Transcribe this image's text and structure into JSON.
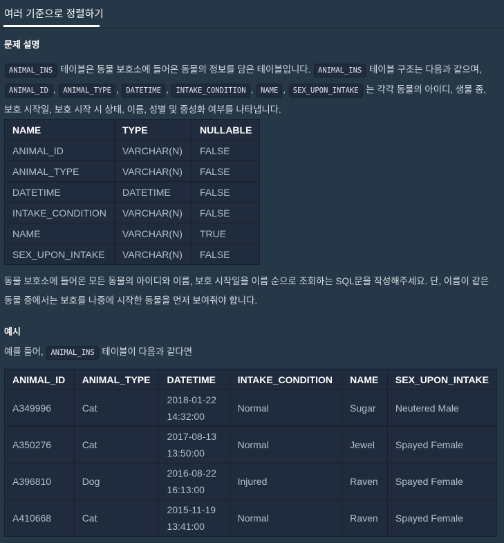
{
  "tab": {
    "label": "여러 기준으로 정렬하기"
  },
  "description": {
    "heading": "문제 설명",
    "p1": {
      "code_table": "ANIMAL_INS",
      "text1": " 테이블은 동물 보호소에 들어온 동물의 정보를 담은 테이블입니다. ",
      "code_table2": "ANIMAL_INS",
      "text2": " 테이블 구조는 다음과 같으며, ",
      "cols": [
        "ANIMAL_ID",
        "ANIMAL_TYPE",
        "DATETIME",
        "INTAKE_CONDITION",
        "NAME",
        "SEX_UPON_INTAKE"
      ],
      "sep": ", ",
      "text3": " 는 각각 동물의 아이디, 생물 종, 보호 시작일, 보호 시작 시 상태, 이름, 성별 및 중성화 여부를 나타냅니다."
    },
    "schema_table": {
      "headers": [
        "NAME",
        "TYPE",
        "NULLABLE"
      ],
      "rows": [
        [
          "ANIMAL_ID",
          "VARCHAR(N)",
          "FALSE"
        ],
        [
          "ANIMAL_TYPE",
          "VARCHAR(N)",
          "FALSE"
        ],
        [
          "DATETIME",
          "DATETIME",
          "FALSE"
        ],
        [
          "INTAKE_CONDITION",
          "VARCHAR(N)",
          "FALSE"
        ],
        [
          "NAME",
          "VARCHAR(N)",
          "TRUE"
        ],
        [
          "SEX_UPON_INTAKE",
          "VARCHAR(N)",
          "FALSE"
        ]
      ]
    },
    "p2": "동물 보호소에 들어온 모든 동물의 아이디와 이름, 보호 시작일을 이름 순으로 조회하는 SQL문을 작성해주세요. 단, 이름이 같은 동물 중에서는 보호를 나중에 시작한 동물을 먼저 보여줘야 합니다."
  },
  "example": {
    "heading": "예시",
    "intro_before": "예를 들어, ",
    "intro_code": "ANIMAL_INS",
    "intro_after": " 테이블이 다음과 같다면",
    "table": {
      "headers": [
        "ANIMAL_ID",
        "ANIMAL_TYPE",
        "DATETIME",
        "INTAKE_CONDITION",
        "NAME",
        "SEX_UPON_INTAKE"
      ],
      "rows": [
        [
          "A349996",
          "Cat",
          "2018-01-22 14:32:00",
          "Normal",
          "Sugar",
          "Neutered Male"
        ],
        [
          "A350276",
          "Cat",
          "2017-08-13 13:50:00",
          "Normal",
          "Jewel",
          "Spayed Female"
        ],
        [
          "A396810",
          "Dog",
          "2016-08-22 16:13:00",
          "Injured",
          "Raven",
          "Spayed Female"
        ],
        [
          "A410668",
          "Cat",
          "2015-11-19 13:41:00",
          "Normal",
          "Raven",
          "Spayed Female"
        ]
      ]
    }
  }
}
